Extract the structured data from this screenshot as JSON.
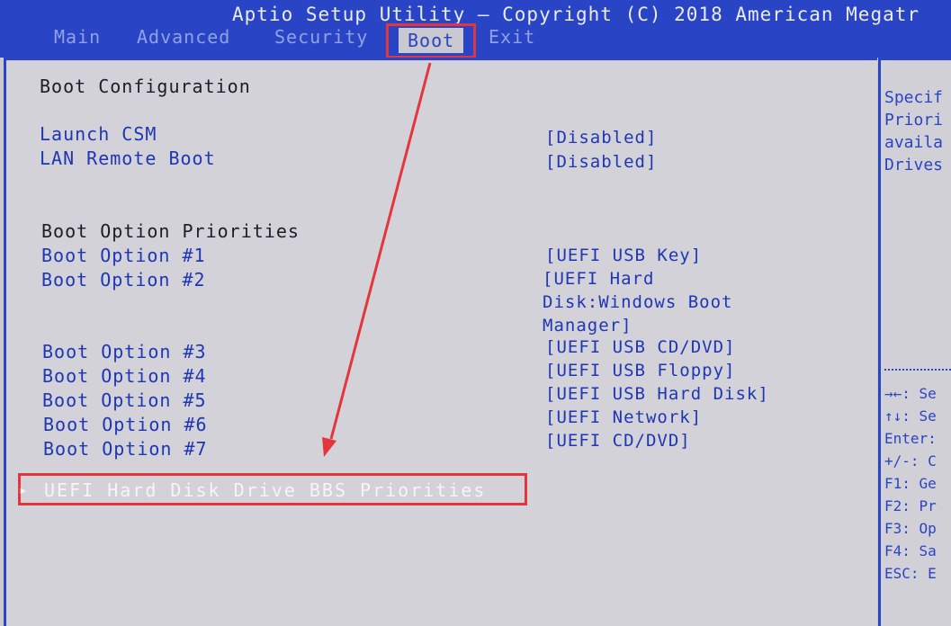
{
  "header": {
    "title": "Aptio Setup Utility – Copyright (C) 2018 American Megatr",
    "tabs": [
      "Main",
      "Advanced",
      "Security",
      "Boot",
      "Exit"
    ],
    "active_tab": "Boot"
  },
  "main": {
    "section_boot_config": "Boot Configuration",
    "launch_csm": {
      "label": "Launch CSM",
      "value": "[Disabled]"
    },
    "lan_remote_boot": {
      "label": "LAN Remote Boot",
      "value": "[Disabled]"
    },
    "section_priorities": "Boot Option Priorities",
    "boot_options": [
      {
        "label": "Boot Option #1",
        "value": "[UEFI USB Key]"
      },
      {
        "label": "Boot Option #2",
        "value": "[UEFI Hard Disk:Windows Boot Manager]"
      },
      {
        "label": "Boot Option #3",
        "value": "[UEFI USB CD/DVD]"
      },
      {
        "label": "Boot Option #4",
        "value": "[UEFI USB Floppy]"
      },
      {
        "label": "Boot Option #5",
        "value": "[UEFI USB Hard Disk]"
      },
      {
        "label": "Boot Option #6",
        "value": "[UEFI Network]"
      },
      {
        "label": "Boot Option #7",
        "value": "[UEFI CD/DVD]"
      }
    ],
    "bbs_item": {
      "arrow": "▸",
      "label": "UEFI Hard Disk Drive BBS Priorities"
    }
  },
  "side": {
    "help_lines": [
      "Specif",
      "Priori",
      "availa",
      "Drives"
    ],
    "key_lines": [
      "→←: Se",
      "↑↓: Se",
      "Enter:",
      "+/-: C",
      "F1: Ge",
      "F2: Pr",
      "F3: Op",
      "F4: Sa",
      "ESC: E"
    ]
  },
  "colors": {
    "accent_blue": "#2a44c6",
    "highlight_red": "#e5353c",
    "panel_gray": "#d2d2d8"
  }
}
